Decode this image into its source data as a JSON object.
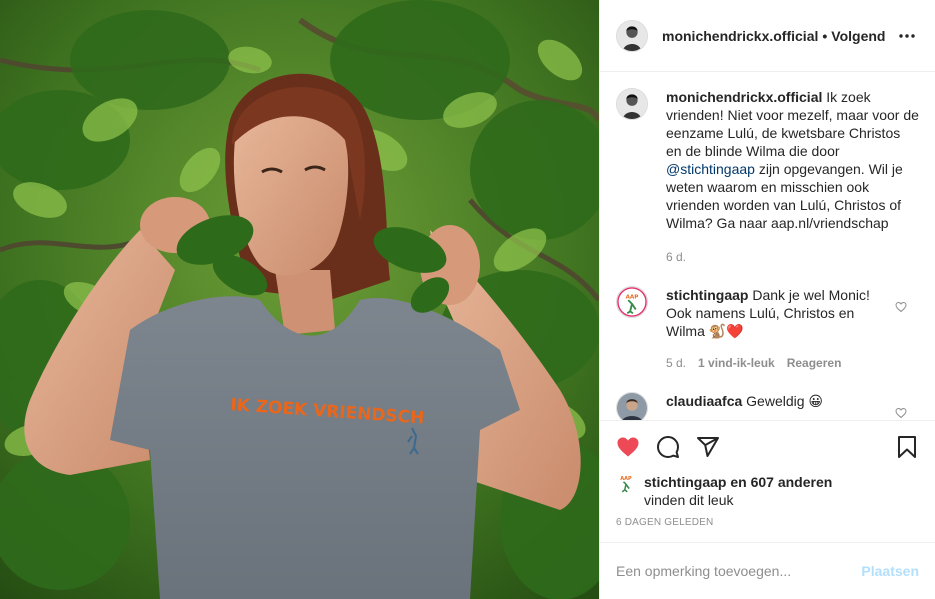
{
  "header": {
    "username": "monichendrickx.official",
    "separator": "•",
    "follow_label": "Volgend",
    "more_icon": "more-horizontal-icon"
  },
  "caption": {
    "username": "monichendrickx.official",
    "text_1": "Ik zoek vrienden! Niet voor mezelf, maar voor de eenzame Lulú, de kwetsbare Christos en de blinde Wilma die door",
    "mention": "@stichtingaap",
    "text_2": "zijn opgevangen. Wil je weten waarom en misschien ook vrienden worden van Lulú, Christos of Wilma? Ga naar aap.nl/vriendschap",
    "time": "6 d."
  },
  "comments": [
    {
      "username": "stichtingaap",
      "text": "Dank je wel Monic! Ook namens Lulú, Christos en Wilma 🐒❤️",
      "time": "5 d.",
      "likes": "1 vind-ik-leuk",
      "reply": "Reageren"
    },
    {
      "username": "claudiaafca",
      "text": "Geweldig 😀"
    }
  ],
  "likes": {
    "username": "stichtingaap",
    "rest": "en 607 anderen",
    "line2": "vinden dit leuk"
  },
  "date": "6 DAGEN GELEDEN",
  "add_comment": {
    "placeholder": "Een opmerking toevoegen...",
    "post_label": "Plaatsen"
  },
  "photo": {
    "shirt_text": "IK ZOEK VRIENDSCH"
  },
  "colors": {
    "like_red": "#ed4956",
    "link_blue": "#00376b",
    "post_disabled": "#b2dffc",
    "shirt_text": "#e8671c"
  }
}
